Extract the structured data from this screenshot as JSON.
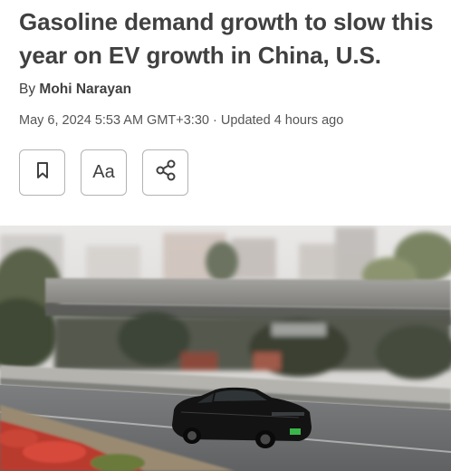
{
  "article": {
    "headline": "Gasoline demand growth to slow this year on EV growth in China, U.S.",
    "byline_prefix": "By",
    "author": "Mohi Narayan",
    "dateline": "May 6, 2024 5:53 AM GMT+3:30 · Updated 4 hours ago"
  },
  "toolbar": {
    "bookmark_icon": "bookmark-icon",
    "text_size_label": "Aa",
    "share_icon": "share-icon"
  },
  "photo": {
    "subject": "photo",
    "colors": {
      "sky": "#e6e4e2",
      "overpass": "#8d8d88",
      "road": "#6e7072",
      "car": "#141414",
      "plate": "#3ab54a"
    }
  }
}
